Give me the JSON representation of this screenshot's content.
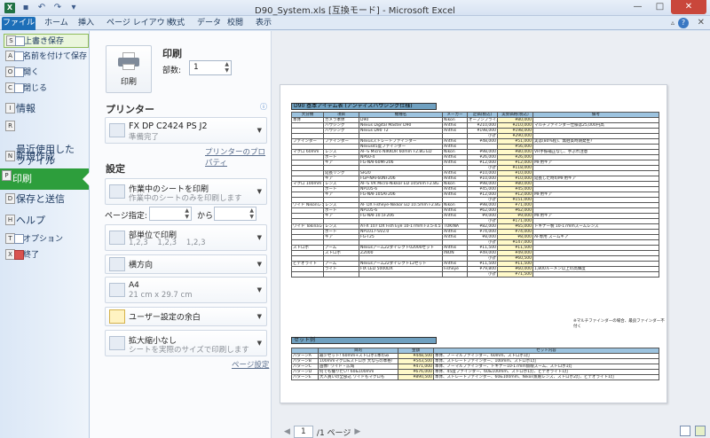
{
  "window": {
    "title": "D90_System.xls [互換モード] - Microsoft Excel",
    "app_icon": "X",
    "min": "—",
    "max": "□",
    "close": "✕"
  },
  "tabs": [
    "ファイル",
    "ホーム",
    "挿入",
    "ページ レイアウト",
    "数式",
    "データ",
    "校閲",
    "表示"
  ],
  "nav": {
    "save": "上書き保存",
    "save_as": "名前を付けて保存",
    "open": "開く",
    "close": "閉じる",
    "info": "情報",
    "recent": "最近使用した\nファイル",
    "new": "新規作成",
    "print": "印刷",
    "send": "保存と送信",
    "help": "ヘルプ",
    "options": "オプション",
    "exit": "終了",
    "keytips": {
      "save": "S",
      "save_as": "A",
      "open": "O",
      "close": "C",
      "info": "I",
      "recent": "R",
      "new": "N",
      "print": "P",
      "send": "D",
      "help": "H",
      "options": "T",
      "exit": "X"
    }
  },
  "print": {
    "button_label": "印刷",
    "heading": "印刷",
    "copies_label": "部数:",
    "copies_value": "1",
    "printer_heading": "プリンター",
    "printer_name": "FX DP C2424 PS J2",
    "printer_status": "準備完了",
    "printer_props": "プリンターのプロパティ",
    "settings_heading": "設定",
    "what": {
      "l1": "作業中のシートを印刷",
      "l2": "作業中のシートのみを印刷します"
    },
    "pages_label": "ページ指定:",
    "pages_to": "から",
    "collate": {
      "l1": "部単位で印刷",
      "l2": "1,2,3    1,2,3    1,2,3"
    },
    "orientation": "横方向",
    "paper": {
      "l1": "A4",
      "l2": "21 cm x 29.7 cm"
    },
    "margins": "ユーザー設定の余白",
    "scaling": {
      "l1": "拡大縮小なし",
      "l2": "シートを実際のサイズで印刷します"
    },
    "page_setup": "ページ設定"
  },
  "preview": {
    "page_current": "1",
    "page_total": "/1 ページ",
    "sheet_title": "D90 基本アイテム表 (アンティスハウジング仕様)",
    "headers": [
      "大分類",
      "項目",
      "機種名",
      "メーカー",
      "定価(税込)",
      "実勢価格(税込)",
      "備考"
    ],
    "rows": [
      [
        "本体",
        "カメラ本体",
        "D90",
        "Nikon",
        "オープンプライス",
        "¥80,000",
        ""
      ],
      [
        "",
        "ハウジング",
        "Nexus Digital Master D90",
        "Anthis",
        "¥210,000",
        "¥210,000",
        "マルチファインダー仕様は25,000円高"
      ],
      [
        "",
        "ハウジング",
        "Nexus D90 T2",
        "Anthis",
        "¥198,000",
        "¥198,000",
        ""
      ],
      [
        "",
        "",
        "",
        "",
        "小計",
        "¥290,000",
        ""
      ],
      [
        "ファインダー",
        "ファインダー",
        "Nexusストレートファインダー",
        "Anthis",
        "¥48,000",
        "¥51,000",
        "実は(80%程)、無伯質時期発生?"
      ],
      [
        "",
        "",
        "Nexus45度ファインダー",
        "Anthis",
        "",
        "¥56,000",
        ""
      ],
      [
        "マクロ\n60mm",
        "レンズ",
        "AF-S Micro NIKKOR 60mm F2.8G ED",
        "Nikon",
        "¥98,000",
        "¥80,000",
        "VR手振補正なし、手ぶれ注意"
      ],
      [
        "",
        "ポート",
        "NP60-4",
        "Anthis",
        "¥26,000",
        "¥26,000",
        ""
      ],
      [
        "",
        "ギア",
        "FG-NAF60MF206",
        "Anthis",
        "¥12,000",
        "¥12,000",
        "MF用ギア"
      ],
      [
        "",
        "",
        "",
        "",
        "小計",
        "¥118,000",
        ""
      ],
      [
        "",
        "延長リング",
        "SR20",
        "Anthis",
        "¥10,000",
        "¥10,000",
        ""
      ],
      [
        "",
        "ギア",
        "FGP-NAF60NF206",
        "Anthis",
        "¥10,000",
        "¥10,000",
        "延長した時のMF用ギア"
      ],
      [
        "マクロ\n100mm",
        "レンズ",
        "AF-S VR Micro-Nikkor ED 105mm F2.8G",
        "Nikon",
        "¥98,000",
        "¥80,000",
        ""
      ],
      [
        "",
        "ポート",
        "NP105-6",
        "Anthis",
        "¥45,000",
        "¥45,000",
        ""
      ],
      [
        "",
        "ギア",
        "FG-NAF105AF206",
        "Anthis",
        "¥12,000",
        "¥12,000",
        "MF用ギア"
      ],
      [
        "",
        "",
        "",
        "",
        "小計",
        "¥151,000",
        ""
      ],
      [
        "ワイド\nNikonレンズ",
        "レンズ",
        "AF DX Fisheye-Nikkor ED 10.5mm F2.8G",
        "Nikon",
        "¥98,000",
        "¥71,000",
        ""
      ],
      [
        "",
        "ポート",
        "NP105-6",
        "Anthis",
        "¥62,000",
        "¥62,000",
        ""
      ],
      [
        "",
        "ギア",
        "FG-NAF10.5F206",
        "Anthis",
        "¥9,000",
        "¥9,000",
        "MF用ギア"
      ],
      [
        "",
        "",
        "",
        "",
        "小計",
        "¥171,000",
        ""
      ],
      [
        "ワイド\nTokinaレンズ",
        "レンズ",
        "AT-X 107 DX Fish Eye 10-17mm F3.5-4.5",
        "TOKINA",
        "¥82,000",
        "¥65,000",
        "トキナー製 10-17mmズームレンズ"
      ],
      [
        "",
        "ポート",
        "NP1017-SV2.0",
        "Anthis",
        "¥74,000",
        "¥74,000",
        ""
      ],
      [
        "",
        "ギア",
        "FG-T25",
        "Anthis",
        "¥8,000",
        "¥8,000",
        "AF専用 ズームギア"
      ],
      [
        "",
        "",
        "",
        "",
        "小計",
        "¥147,000",
        ""
      ],
      [
        "ストロボ",
        "アーム",
        "Nexusアーム22ダイレクト02000セット",
        "Anthis",
        "¥11,500",
        "¥11,500",
        ""
      ],
      [
        "",
        "ストロボ",
        "Z2000",
        "INON",
        "¥49,000",
        "¥49,000",
        ""
      ],
      [
        "",
        "",
        "",
        "",
        "小計",
        "¥60,500",
        ""
      ],
      [
        "ビデオライト",
        "アーム",
        "Nexusアーム22ダイレクト12セット",
        "Anthis",
        "¥11,500",
        "¥11,500",
        ""
      ],
      [
        "",
        "ライト",
        "FIX LED 5000DX",
        "Fisheye",
        "¥79,800",
        "¥60,000",
        "1,800ルーメン以上の高輝度"
      ],
      [
        "",
        "",
        "",
        "",
        "小計",
        "¥71,500",
        ""
      ]
    ],
    "note": "※マルチファインダーの場合、最良ファインダー不付く",
    "set_title": "セット例",
    "set_headers": [
      "",
      "目的",
      "金額",
      "セット内容"
    ],
    "set_rows": [
      [
        "パターンA",
        "最少セット! 60mm+ストロボ1本のみ",
        "¥448,500",
        "本体、ノーマルファインダー、60mm、ストロボ1灯"
      ],
      [
        "パターンB",
        "100mmマクロ&ストロボ 大ならの本格!",
        "¥543,500",
        "本体、ストレートファインダー、100mm、ストロボ1灯"
      ],
      [
        "パターンC",
        "画像! ワイド・広域",
        "¥471,000",
        "本体、ノーマルファインダー、トキナー10-17mm魚眼ズーム、ストロボ1灯"
      ],
      [
        "パターンD",
        "何でも撮りたい! 60&100mm",
        "¥676,000",
        "本体、45度ファインダー、60&100mm、ストロボ1灯、ビデオライト1灯"
      ],
      [
        "パターンE",
        "大人買いの全部込 ワイドもマクロも",
        "¥890,500",
        "本体、ストレートファインダー、60&100mm、Nikon魚眼レンズ、ストロボ2灯、ビデオライト1灯"
      ]
    ]
  }
}
